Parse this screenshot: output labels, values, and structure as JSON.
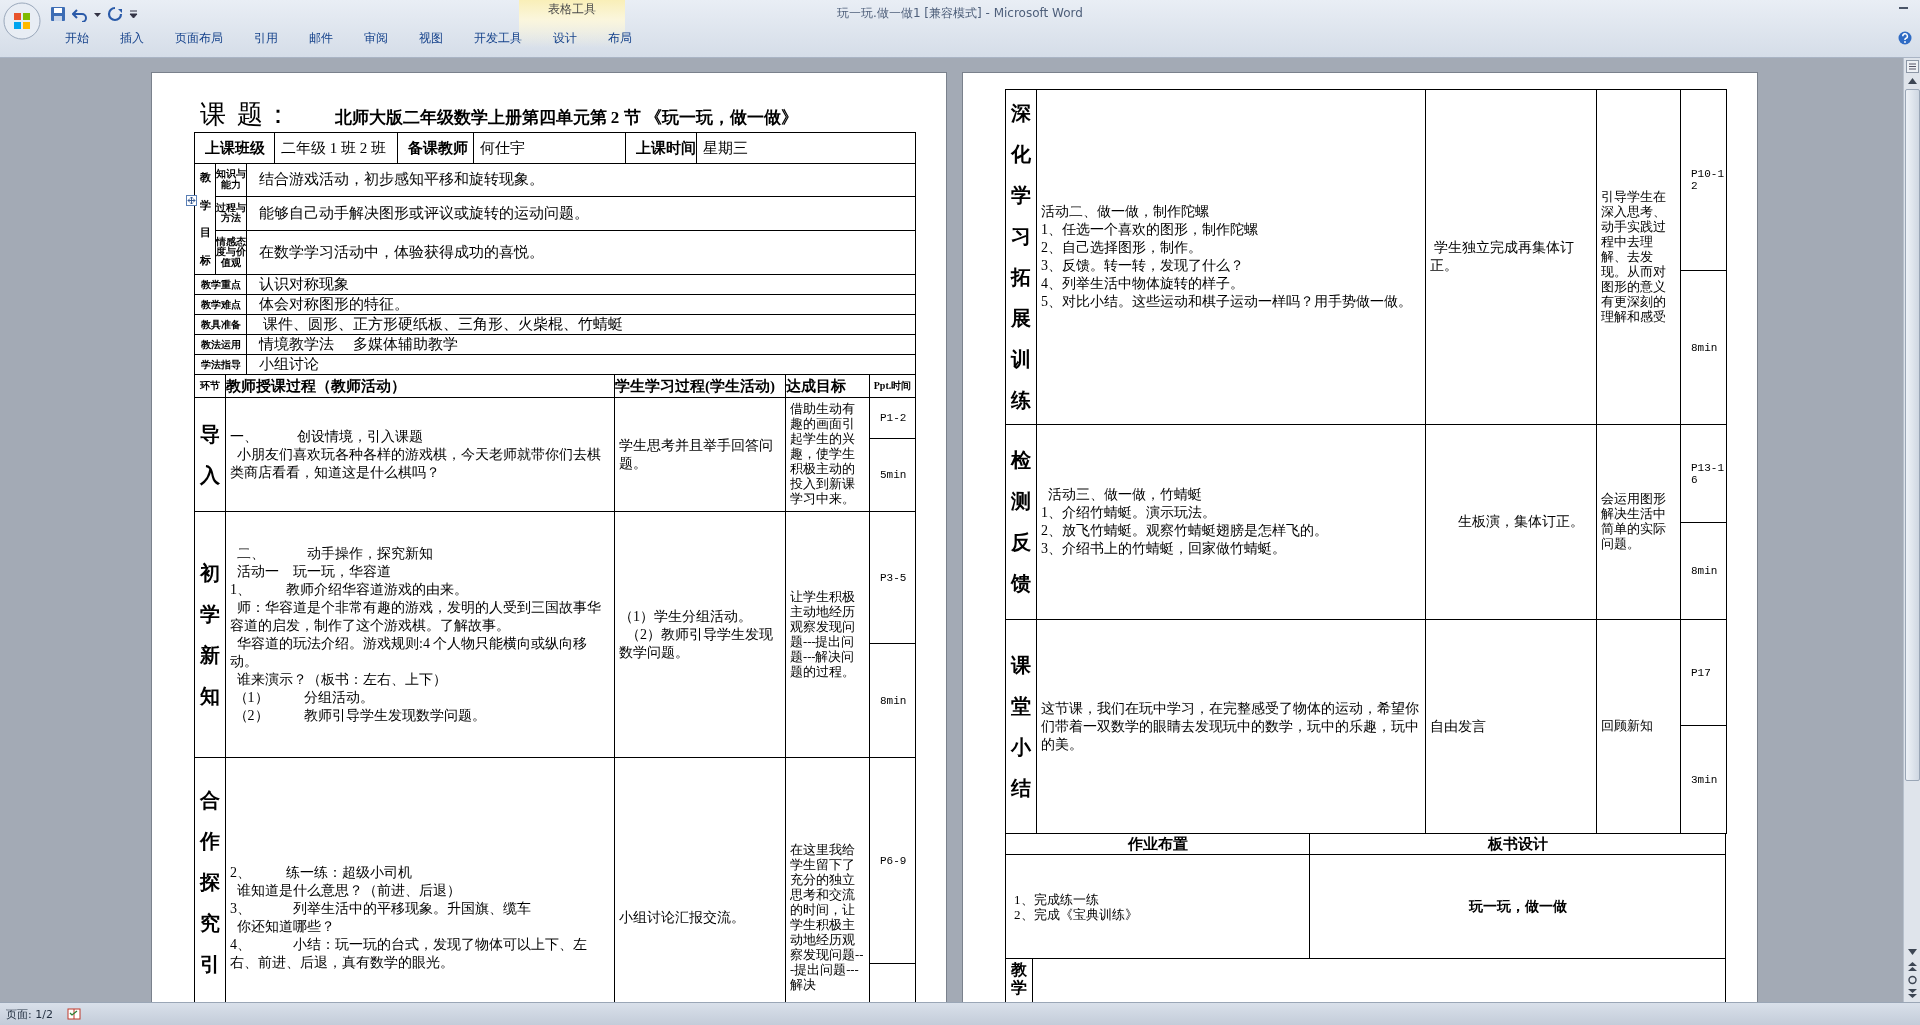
{
  "window": {
    "title": "玩一玩.做一做1 [兼容模式] - Microsoft Word"
  },
  "ribbon": {
    "tabs": [
      {
        "label": "开始",
        "selected": false
      },
      {
        "label": "插入",
        "selected": false
      },
      {
        "label": "页面布局",
        "selected": false
      },
      {
        "label": "引用",
        "selected": false
      },
      {
        "label": "邮件",
        "selected": false
      },
      {
        "label": "审阅",
        "selected": false
      },
      {
        "label": "视图",
        "selected": false
      },
      {
        "label": "开发工具",
        "selected": false
      }
    ],
    "table_tools": {
      "label": "表格工具",
      "tabs": [
        {
          "label": "设计",
          "selected": false
        },
        {
          "label": "布局",
          "selected": false
        }
      ]
    }
  },
  "pages": [
    {
      "heading": {
        "label": "课 题：",
        "title": "北师大版二年级数学上册第四单元第 2 节 《玩一玩，做一做》"
      },
      "info_row": [
        {
          "label": "上课班级",
          "value": "二年级 1 班 2 班"
        },
        {
          "label": "备课教师",
          "value": "何仕宇"
        },
        {
          "label": "上课时间",
          "value": "星期三"
        }
      ],
      "objectives": {
        "label": "教学目标",
        "items": [
          {
            "aspect": "知识与能力",
            "text": "结合游戏活动，初步感知平移和旋转现象。"
          },
          {
            "aspect": "过程与方法",
            "text": "能够自己动手解决图形或评议或旋转的运动问题。"
          },
          {
            "aspect": "情感态度与价值观",
            "text": "在数学学习活动中，体验获得成功的喜悦。"
          }
        ]
      },
      "fields": [
        {
          "label": "教学重点",
          "text": "认识对称现象"
        },
        {
          "label": "教学难点",
          "text": "体会对称图形的特征。"
        },
        {
          "label": "教具准备",
          "text": " 课件、圆形、正方形硬纸板、三角形、火柴棍、竹蜻蜓"
        },
        {
          "label": "教法运用",
          "text": "情境教学法     多媒体辅助教学"
        },
        {
          "label": "学法指导",
          "text": "小组讨论"
        }
      ],
      "columns": [
        "环节",
        "教师授课过程（教师活动）",
        "学生学习过程(学生活动)",
        "达成目标",
        "Ppt.时间"
      ],
      "stages": [
        {
          "stage": "导入",
          "teacher": [
            "一、           创设情境，引入课题",
            "  小朋友们喜欢玩各种各样的游戏棋，今天老师就带你们去棋类商店看看，知道这是什么棋吗？"
          ],
          "student": [
            "学生思考并且举手回答问题。"
          ],
          "goal": "借助生动有趣的画面引起学生的兴趣，使学生积极主动的投入到新课学习中来。",
          "ppt": "P1-2",
          "time": "5min"
        },
        {
          "stage": "初学新知",
          "teacher": [
            "  二、            动手操作，探究新知",
            "  活动一    玩一玩，华容道",
            "1、          教师介绍华容道游戏的由来。",
            "  师：华容道是个非常有趣的游戏，发明的人受到三国故事华容道的启发，制作了这个游戏棋。了解故事。",
            "  华容道的玩法介绍。游戏规则:4 个人物只能横向或纵向移动。",
            "  谁来演示？（板书：左右、上下）",
            " （1）          分组活动。",
            " （2）          教师引导学生发现数学问题。"
          ],
          "student": [
            "（1）学生分组活动。",
            "  （2）教师引导学生发现数学问题。"
          ],
          "goal": "让学生积极主动地经历观察发现问题---提出问题---解决问题的过程。",
          "ppt": "P3-5",
          "time": "8min"
        },
        {
          "stage": "合作探究引",
          "teacher": [
            "2、          练一练：超级小司机",
            "  谁知道是什么意思？（前进、后退）",
            "3、            列举生活中的平移现象。升国旗、缆车",
            "  你还知道哪些？",
            "4、            小结：玩一玩的台式，发现了物体可以上下、左右、前进、后退，真有数学的眼光。"
          ],
          "student": [
            "小组讨论汇报交流。"
          ],
          "goal": "在这里我给学生留下了充分的独立思考和交流的时间，让学生积极主动地经历观察发现问题---提出问题---解决",
          "ppt": "P6-9"
        }
      ]
    },
    {
      "stages": [
        {
          "stage": "深化学习拓展训练",
          "teacher": [
            "活动二、做一做，制作陀螺",
            "1、任选一个喜欢的图形，制作陀螺",
            "2、自己选择图形，制作。",
            "3、反馈。转一转，发现了什么？",
            "4、列举生活中物体旋转的样子。",
            "5、对比小结。这些运动和棋子运动一样吗？用手势做一做。"
          ],
          "student": [
            " 学生独立完成再集体订正。"
          ],
          "goal": "引导学生在深入思考、动手实践过程中去理解、去发现。从而对图形的意义有更深刻的理解和感受",
          "ppt": "P10-12",
          "time": "8min"
        },
        {
          "stage": "检测反馈",
          "teacher": [
            "  活动三、做一做，竹蜻蜓",
            "1、介绍竹蜻蜓。演示玩法。",
            "2、放飞竹蜻蜓。观察竹蜻蜓翅膀是怎样飞的。",
            "3、介绍书上的竹蜻蜓，回家做竹蜻蜓。"
          ],
          "student": [
            "        生板演，集体订正。"
          ],
          "goal": "会运用图形解决生活中简单的实际问题。",
          "ppt": "P13-16",
          "time": "8min"
        },
        {
          "stage": "课堂小结",
          "teacher": [
            "这节课，我们在玩中学习，在完整感受了物体的运动，希望你们带着一双数学的眼睛去发现玩中的数学，玩中的乐趣，玩中的美。"
          ],
          "student": [
            "自由发言"
          ],
          "goal": "回顾新知",
          "ppt": "P17",
          "time": "3min"
        }
      ],
      "homework": {
        "label": "作业布置",
        "lines": [
          "1、完成练一练",
          "2、完成《宝典训练》"
        ]
      },
      "board": {
        "label": "板书设计",
        "text": "玩一玩，做一做"
      },
      "reflection": {
        "label": "教学"
      }
    }
  ],
  "status_bar": {
    "page": "页面: 1/2"
  }
}
